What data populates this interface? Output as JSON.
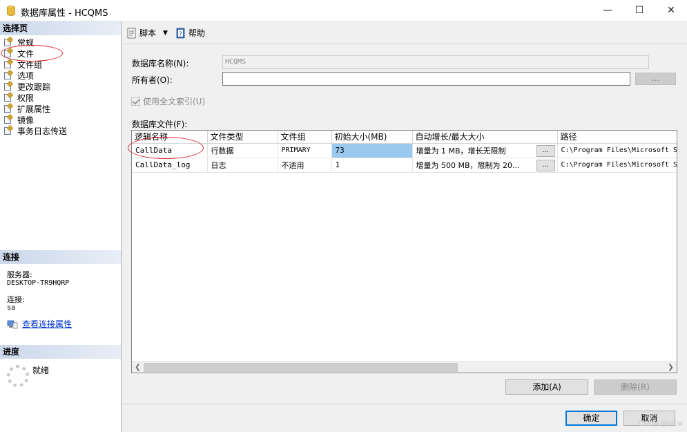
{
  "window": {
    "title": "数据库属性 - HCQMS",
    "minimize_glyph": "—",
    "maximize_glyph": "☐",
    "close_glyph": "✕"
  },
  "left": {
    "select_page_header": "选择页",
    "pages": [
      {
        "label": "常规",
        "icon": "page-wrench-icon"
      },
      {
        "label": "文件",
        "icon": "page-wrench-icon"
      },
      {
        "label": "文件组",
        "icon": "page-wrench-icon"
      },
      {
        "label": "选项",
        "icon": "page-wrench-icon"
      },
      {
        "label": "更改跟踪",
        "icon": "page-wrench-icon"
      },
      {
        "label": "权限",
        "icon": "page-wrench-icon"
      },
      {
        "label": "扩展属性",
        "icon": "page-wrench-icon"
      },
      {
        "label": "镜像",
        "icon": "page-wrench-icon"
      },
      {
        "label": "事务日志传送",
        "icon": "page-wrench-icon"
      }
    ],
    "connection_header": "连接",
    "server_label": "服务器:",
    "server_value": "DESKTOP-TR9HQRP",
    "connection_label": "连接:",
    "connection_value": "sa",
    "view_conn_props": "查看连接属性",
    "progress_header": "进度",
    "progress_status": "就绪"
  },
  "toolbar": {
    "script_label": "脚本",
    "help_label": "帮助"
  },
  "form": {
    "db_name_label": "数据库名称(N):",
    "db_name_value": "HCQMS",
    "owner_label": "所有者(O):",
    "owner_value": "",
    "browse_label": "...",
    "fulltext_label": "使用全文索引(U)",
    "db_files_label": "数据库文件(F):"
  },
  "files_table": {
    "columns": [
      "逻辑名称",
      "文件类型",
      "文件组",
      "初始大小(MB)",
      "自动增长/最大大小",
      "路径"
    ],
    "rows": [
      {
        "name": "CallData",
        "type": "行数据",
        "filegroup": "PRIMARY",
        "size": "73",
        "growth": "增量为 1 MB，增长无限制",
        "path": "C:\\Program Files\\Microsoft S"
      },
      {
        "name": "CallData_log",
        "type": "日志",
        "filegroup": "不适用",
        "size": "1",
        "growth": "增量为 500 MB，限制为 20...",
        "path": "C:\\Program Files\\Microsoft S"
      }
    ],
    "ellipsis": "..."
  },
  "buttons": {
    "add": "添加(A)",
    "remove": "删除(R)",
    "ok": "确定",
    "cancel": "取消"
  },
  "watermark": "CSDN @lxcw"
}
